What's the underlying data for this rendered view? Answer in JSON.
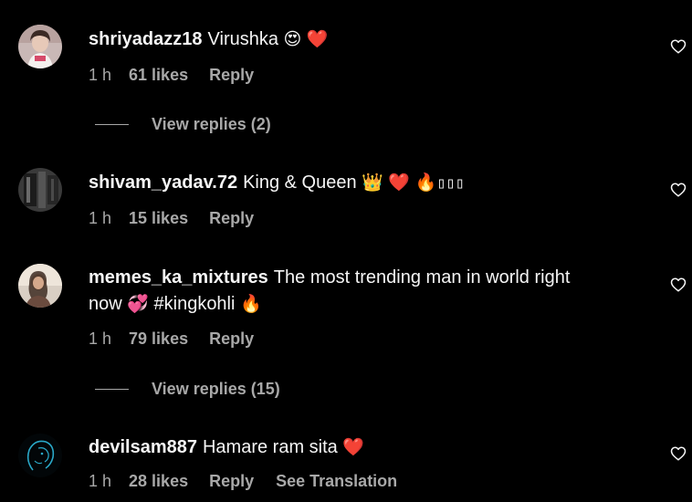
{
  "comments": [
    {
      "username": "shriyadazz18",
      "text": "Virushka",
      "emojis": [
        "😍",
        "❤️"
      ],
      "time": "1 h",
      "likes": "61 likes",
      "reply_label": "Reply",
      "view_replies": "View replies (2)"
    },
    {
      "username": "shivam_yadav.72",
      "text": "King & Queen",
      "emojis": [
        "👑",
        "❤️",
        "🔥"
      ],
      "unrendered_glyphs": "▯▯▯",
      "time": "1 h",
      "likes": "15 likes",
      "reply_label": "Reply"
    },
    {
      "username": "memes_ka_mixtures",
      "text": "The most trending man in world right",
      "text_line2": "now",
      "hashtag": "#kingkohli",
      "emojis": [
        "💞",
        "🔥"
      ],
      "time": "1 h",
      "likes": "79 likes",
      "reply_label": "Reply",
      "view_replies": "View replies (15)"
    },
    {
      "username": "devilsam887",
      "text": "Hamare ram sita",
      "emojis": [
        "❤️"
      ],
      "time": "1 h",
      "likes": "28 likes",
      "reply_label": "Reply",
      "see_translation": "See Translation"
    }
  ],
  "icons": {
    "like": "heart-outline-icon",
    "avatar": "profile-avatar"
  },
  "colors": {
    "background": "#000000",
    "primary_text": "#f5f5f5",
    "secondary_text": "#a8a8a8",
    "heart_red": "#e0142f"
  }
}
